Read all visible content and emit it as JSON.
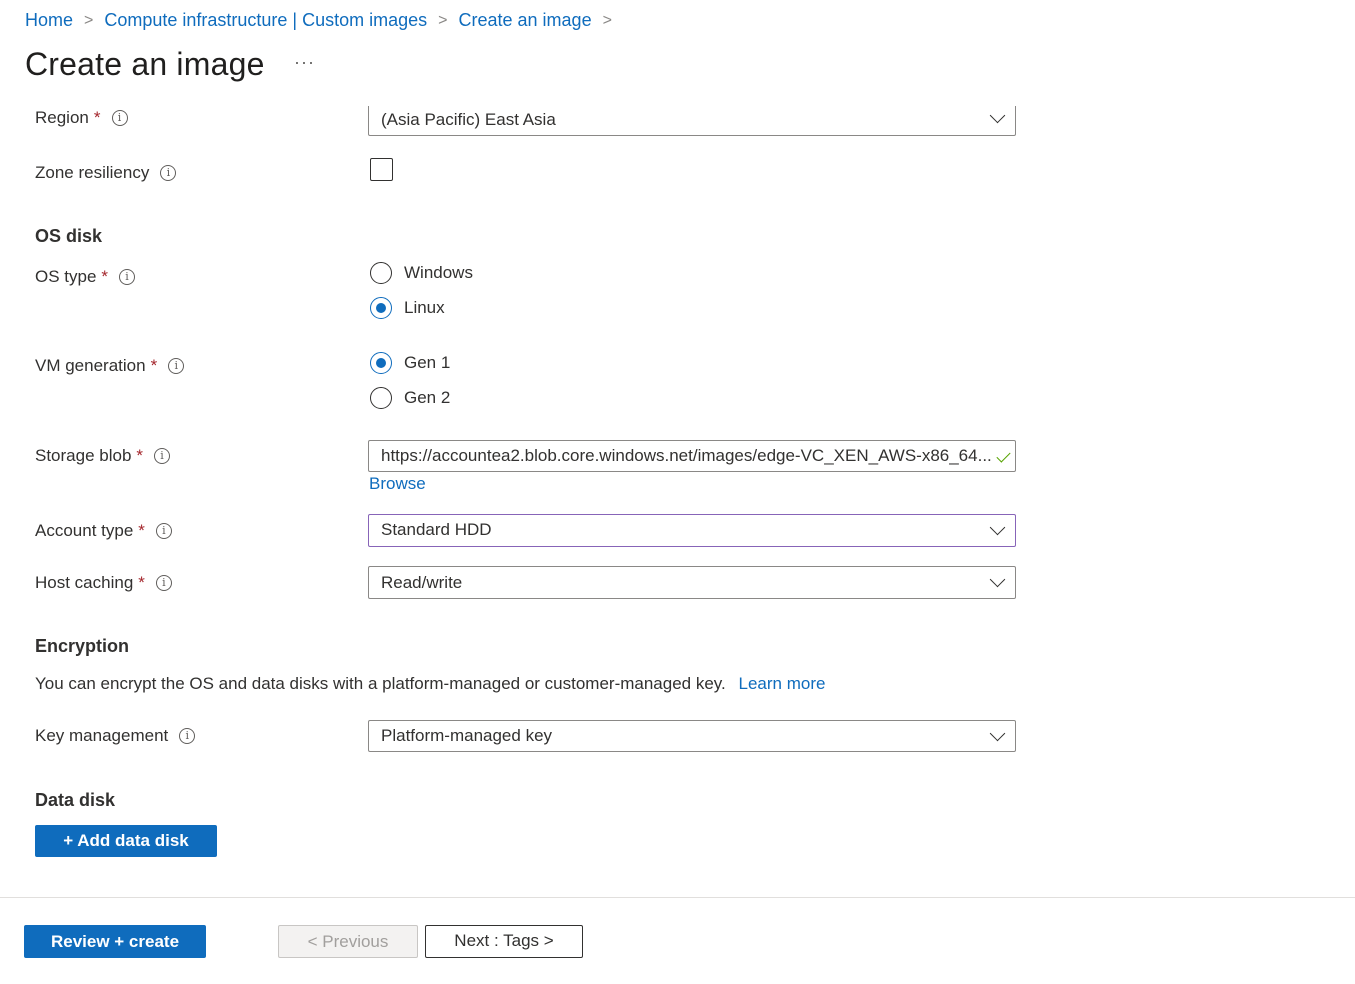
{
  "breadcrumb": {
    "items": [
      "Home",
      "Compute infrastructure | Custom images",
      "Create an image"
    ],
    "separator": ">"
  },
  "page": {
    "title": "Create an image",
    "more": "···"
  },
  "form": {
    "region": {
      "label": "Region",
      "value": "(Asia Pacific) East Asia"
    },
    "zone_resiliency": {
      "label": "Zone resiliency",
      "checked": false
    },
    "os_disk": {
      "heading": "OS disk",
      "os_type": {
        "label": "OS type",
        "options": [
          "Windows",
          "Linux"
        ],
        "selected": "Linux"
      },
      "vm_generation": {
        "label": "VM generation",
        "options": [
          "Gen 1",
          "Gen 2"
        ],
        "selected": "Gen 1"
      },
      "storage_blob": {
        "label": "Storage blob",
        "value": "https://accountea2.blob.core.windows.net/images/edge-VC_XEN_AWS-x86_64...",
        "browse": "Browse"
      },
      "account_type": {
        "label": "Account type",
        "value": "Standard HDD"
      },
      "host_caching": {
        "label": "Host caching",
        "value": "Read/write"
      }
    },
    "encryption": {
      "heading": "Encryption",
      "description": "You can encrypt the OS and data disks with a platform-managed or customer-managed key.",
      "learn_more": "Learn more",
      "key_management": {
        "label": "Key management",
        "value": "Platform-managed key"
      }
    },
    "data_disk": {
      "heading": "Data disk",
      "add_button": "+ Add data disk"
    },
    "required_mark": "*",
    "info_glyph": "i"
  },
  "footer": {
    "review_create": "Review + create",
    "previous": "< Previous",
    "next": "Next : Tags >"
  },
  "colors": {
    "accent": "#0f6cbd",
    "required": "#a4262c",
    "focus": "#8764b8",
    "valid": "#57a300"
  }
}
